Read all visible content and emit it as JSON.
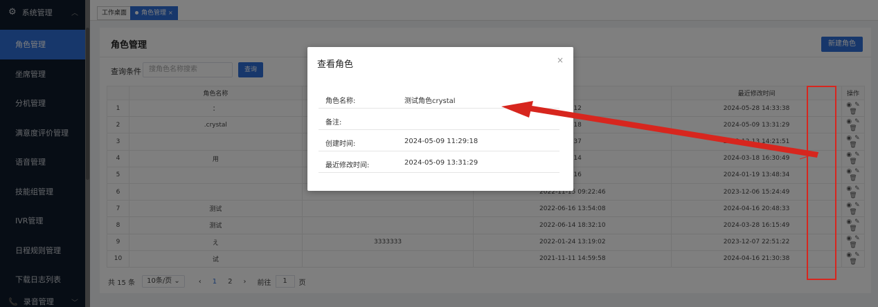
{
  "sidebar": {
    "header": "系统管理",
    "items": [
      {
        "label": "角色管理",
        "active": true
      },
      {
        "label": "坐席管理"
      },
      {
        "label": "分机管理"
      },
      {
        "label": "满意度评价管理"
      },
      {
        "label": "语音管理"
      },
      {
        "label": "技能组管理"
      },
      {
        "label": "IVR管理"
      },
      {
        "label": "日程规则管理"
      },
      {
        "label": "下载日志列表"
      }
    ],
    "footer": "录音管理"
  },
  "tabs": [
    {
      "label": "工作桌面"
    },
    {
      "label": "角色管理",
      "active": true
    }
  ],
  "page": {
    "title": "角色管理",
    "new_button": "新建角色",
    "query_label": "查询条件",
    "search_placeholder": "搜角色名称搜索",
    "query_button": "查询"
  },
  "table": {
    "columns": [
      "",
      "角色名称",
      "",
      "",
      "最近修改时间",
      "操作"
    ],
    "rows": [
      {
        "idx": "1",
        "name": "：",
        "remark": "",
        "ctime": "26:12",
        "mtime": "2024-05-28 14:33:38"
      },
      {
        "idx": "2",
        "name": ".crystal",
        "remark": "",
        "ctime": "29:18",
        "mtime": "2024-05-09 13:31:29"
      },
      {
        "idx": "3",
        "name": "",
        "remark": "",
        "ctime": "02:37",
        "mtime": "2023-12-13 14:21:51"
      },
      {
        "idx": "4",
        "name": "用",
        "remark": "",
        "ctime": "44:14",
        "mtime": "2024-03-18 16:30:49"
      },
      {
        "idx": "5",
        "name": "",
        "remark": "",
        "ctime": "04:16",
        "mtime": "2024-01-19 13:48:34"
      },
      {
        "idx": "6",
        "name": "",
        "remark": "",
        "ctime": "2022-11-15 09:22:46",
        "mtime": "2023-12-06 15:24:49"
      },
      {
        "idx": "7",
        "name": "测试",
        "remark": "",
        "ctime": "2022-06-16 13:54:08",
        "mtime": "2024-04-16 20:48:33"
      },
      {
        "idx": "8",
        "name": "测试",
        "remark": "",
        "ctime": "2022-06-14 18:32:10",
        "mtime": "2024-03-28 16:15:49"
      },
      {
        "idx": "9",
        "name": "え",
        "remark": "3333333",
        "ctime": "2022-01-24 13:19:02",
        "mtime": "2023-12-07 22:51:22"
      },
      {
        "idx": "10",
        "name": "试",
        "remark": "",
        "ctime": "2021-11-11 14:59:58",
        "mtime": "2024-04-16 21:30:38"
      }
    ]
  },
  "pager": {
    "total": "共 15 条",
    "page_size": "10条/页",
    "prev": "‹",
    "pages": [
      "1",
      "2"
    ],
    "next": "›",
    "goto": "前往",
    "goto_value": "1",
    "page_unit": "页"
  },
  "modal": {
    "title": "查看角色",
    "close": "×",
    "fields": [
      {
        "key": "角色名称:",
        "value": "测试角色crystal"
      },
      {
        "key": "备注:",
        "value": ""
      },
      {
        "key": "创建时间:",
        "value": "2024-05-09 11:29:18"
      },
      {
        "key": "最近修改时间:",
        "value": "2024-05-09 13:31:29"
      }
    ]
  },
  "icons": {
    "view": "eye-icon",
    "edit": "edit-icon",
    "delete": "trash-icon",
    "settings": "gear-icon"
  },
  "colors": {
    "accent": "#2f6fd6",
    "sidebar_bg": "#0f1a2a",
    "annotation": "#d7261e"
  }
}
